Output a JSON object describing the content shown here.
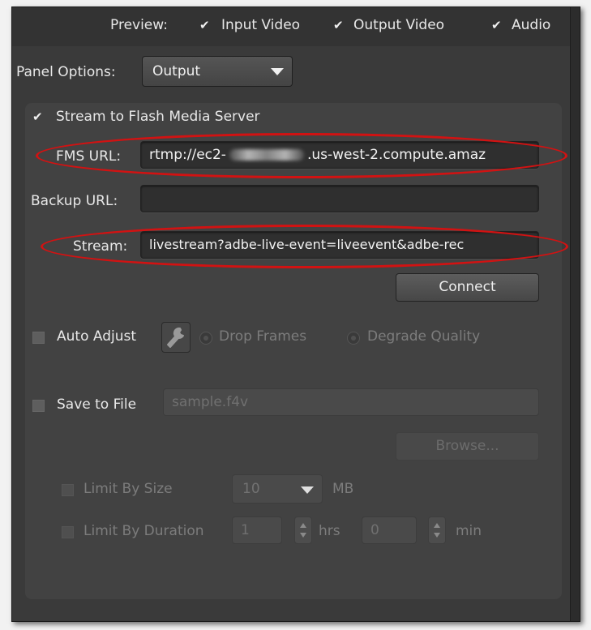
{
  "preview": {
    "label": "Preview:",
    "items": [
      {
        "label": "Input Video",
        "checked": true
      },
      {
        "label": "Output Video",
        "checked": true
      },
      {
        "label": "Audio",
        "checked": true
      }
    ]
  },
  "panel_options": {
    "label": "Panel Options:",
    "selected": "Output"
  },
  "stream_to_fms": {
    "label": "Stream to Flash Media Server",
    "checked": true
  },
  "fms_url": {
    "label": "FMS URL:",
    "value_prefix": "rtmp://ec2-",
    "value_suffix": ".us-west-2.compute.amaz"
  },
  "backup_url": {
    "label": "Backup URL:",
    "value": ""
  },
  "stream": {
    "label": "Stream:",
    "value": "livestream?adbe-live-event=liveevent&adbe-rec"
  },
  "connect_button": "Connect",
  "auto_adjust": {
    "label": "Auto Adjust",
    "checked": false,
    "options": [
      "Drop Frames",
      "Degrade Quality"
    ]
  },
  "save_to_file": {
    "label": "Save to File",
    "checked": false,
    "placeholder": "sample.f4v"
  },
  "browse_button": "Browse...",
  "limit_by_size": {
    "label": "Limit By Size",
    "value": "10",
    "unit": "MB"
  },
  "limit_by_duration": {
    "label": "Limit By Duration",
    "hours": "1",
    "hours_unit": "hrs",
    "minutes": "0",
    "minutes_unit": "min"
  },
  "colors": {
    "highlight": "#d21212",
    "panel_bg": "#424242",
    "window_bg": "#3a3a3a"
  }
}
